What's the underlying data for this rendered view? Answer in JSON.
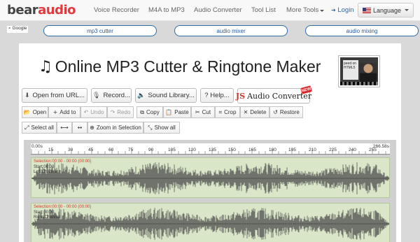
{
  "brand": {
    "part1": "bear",
    "part2": "audio"
  },
  "nav": {
    "items": [
      "Voice Recorder",
      "M4A to MP3",
      "Audio Converter",
      "Tool List",
      "More Tools"
    ],
    "login": "Login",
    "language": "Language"
  },
  "search": {
    "badge": "Google",
    "pills": [
      "mp3 cutter",
      "audio mixer",
      "audio mixing"
    ]
  },
  "page": {
    "title": "Online MP3 Cutter & Ringtone Maker",
    "thumb_text": "peed on HTML5"
  },
  "actions": {
    "open_url": "Open from URL...",
    "record": "Record...",
    "library": "Sound Library...",
    "help": "? Help...",
    "js_prefix": "JS",
    "js_label": "Audio Converter",
    "new_badge": "NEW"
  },
  "toolbar": {
    "open": "Open",
    "add": "Add to",
    "undo": "Undo",
    "redo": "Redo",
    "copy": "Copy",
    "paste": "Paste",
    "cut": "Cut",
    "crop": "Crop",
    "delete": "Delete",
    "restore": "Restore",
    "select_all": "Select all",
    "zoom_selection": "Zoom in Selection",
    "show_all": "Show all"
  },
  "ruler": {
    "start": "0.00s",
    "end": "266.58s",
    "ticks": [
      "15",
      "30",
      "45",
      "60",
      "75",
      "90",
      "105",
      "120",
      "135",
      "150",
      "165",
      "180",
      "195",
      "210",
      "225",
      "240",
      "255"
    ]
  },
  "tracks": [
    {
      "selection": "Selection:00:00 - 00:00 (00:00)",
      "start": "Start:00:00",
      "channel": "Left Channel"
    },
    {
      "selection": "Selection:00:00 - 00:00 (00:00)",
      "start": "Start:00:00",
      "channel": "Right Channel"
    }
  ],
  "colors": {
    "brand_red": "#e03a3e",
    "wave": "#555555",
    "track_bg": "#d9e6c8",
    "pill_border": "#2b6ca8"
  }
}
